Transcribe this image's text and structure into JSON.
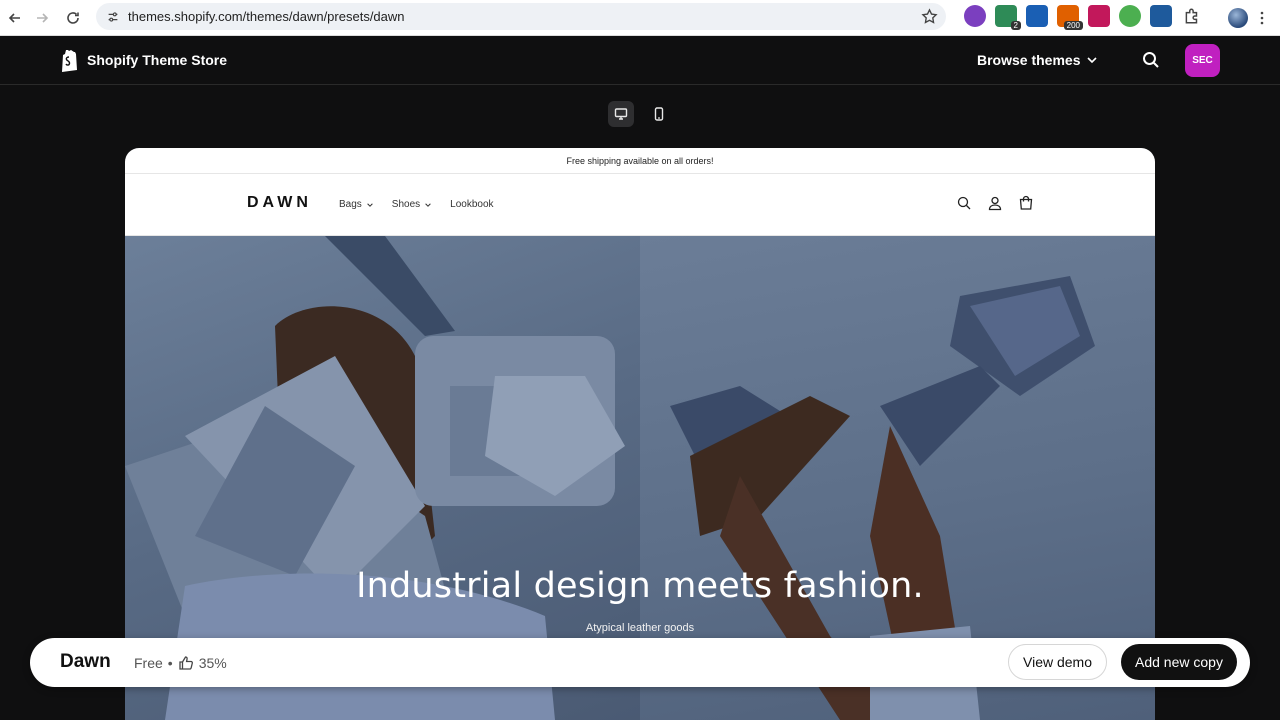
{
  "browser": {
    "url": "themes.shopify.com/themes/dawn/presets/dawn",
    "extensions": [
      {
        "icon": "flower-ext-icon",
        "color": "#7b3fbf",
        "badge": ""
      },
      {
        "icon": "chat-ext-icon",
        "color": "#2e8b57",
        "badge": "2"
      },
      {
        "icon": "at-ext-icon",
        "color": "#1a5fb4",
        "badge": ""
      },
      {
        "icon": "counter-ext-icon",
        "color": "#e06000",
        "badge": "200"
      },
      {
        "icon": "download-ext-icon",
        "color": "#c2185b",
        "badge": ""
      },
      {
        "icon": "puzzle-green-ext-icon",
        "color": "#4caf50",
        "badge": ""
      },
      {
        "icon": "grid-ext-icon",
        "color": "#1e5a9c",
        "badge": ""
      }
    ]
  },
  "store": {
    "logo_text": "Shopify Theme Store",
    "browse_label": "Browse themes",
    "avatar_initials": "SEC",
    "accent": "#c020c0"
  },
  "preview": {
    "announcement": "Free shipping available on all orders!",
    "brand": "DAWN",
    "nav": [
      "Bags",
      "Shoes",
      "Lookbook"
    ],
    "hero_title": "Industrial design meets fashion.",
    "hero_subtitle": "Atypical leather goods"
  },
  "bottom_bar": {
    "theme_name": "Dawn",
    "price": "Free",
    "separator": "•",
    "rating": "35%",
    "view_demo_label": "View demo",
    "add_copy_label": "Add new copy"
  }
}
